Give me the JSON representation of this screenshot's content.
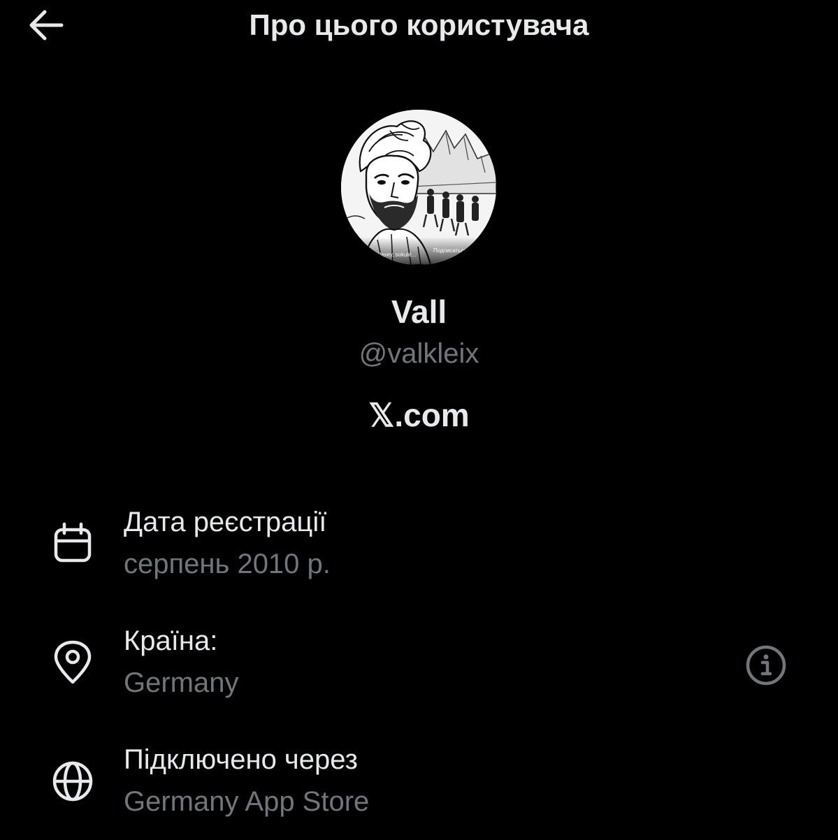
{
  "header": {
    "title": "Про цього користувача",
    "back_icon": "arrow-left-icon"
  },
  "profile": {
    "display_name": "Vall",
    "handle": "@valkleix",
    "source": "𝕏.com",
    "avatar_caption_left": "Чехеу, sokulé...",
    "avatar_caption_right": "Подписаться"
  },
  "details": {
    "joined": {
      "label": "Дата реєстрації",
      "value": "серпень 2010 р.",
      "icon": "calendar-icon"
    },
    "country": {
      "label": "Країна:",
      "value": "Germany",
      "icon": "location-pin-icon",
      "info_icon": "info-icon"
    },
    "connected_via": {
      "label": "Підключено через",
      "value": "Germany App Store",
      "icon": "globe-icon"
    }
  },
  "colors": {
    "background": "#000000",
    "primary_text": "#e7e9ea",
    "secondary_text": "#71767b"
  }
}
